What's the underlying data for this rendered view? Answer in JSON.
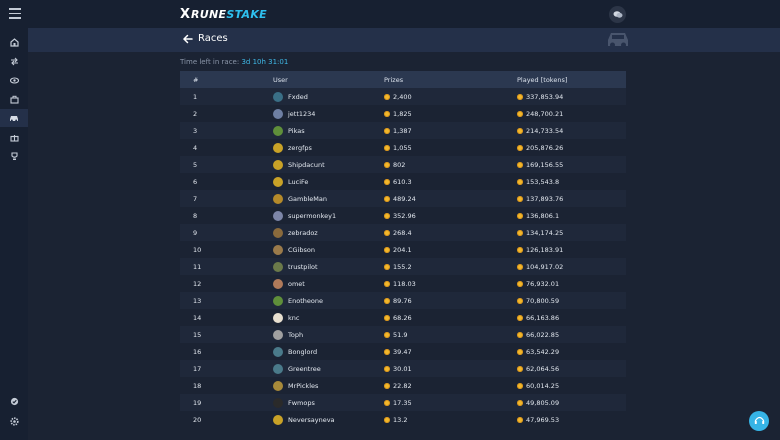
{
  "app": {
    "logo_x": "X",
    "logo_word_1": "RUNE",
    "logo_word_2": "STAKE"
  },
  "sidebar": {
    "items": [
      {
        "icon": "home-icon"
      },
      {
        "icon": "swap-icon"
      },
      {
        "icon": "eye-icon"
      },
      {
        "icon": "briefcase-icon"
      },
      {
        "icon": "car-icon",
        "active": true
      },
      {
        "icon": "gift-icon"
      },
      {
        "icon": "trophy-icon"
      },
      {
        "icon": "shield-icon"
      },
      {
        "icon": "settings-icon"
      }
    ]
  },
  "header": {
    "title": "Races"
  },
  "timer": {
    "label": "Time left in race:",
    "value": "3d 10h 31:01"
  },
  "table": {
    "columns": [
      "#",
      "User",
      "Prizes",
      "Played [tokens]"
    ],
    "rows": [
      {
        "rank": "1",
        "user": "Fxded",
        "prize": "2,400",
        "played": "337,853.94",
        "avatar_color": "#3a6f86"
      },
      {
        "rank": "2",
        "user": "jett1234",
        "prize": "1,825",
        "played": "248,700.21",
        "avatar_color": "#6e7fa3"
      },
      {
        "rank": "3",
        "user": "Pikas",
        "prize": "1,387",
        "played": "214,733.54",
        "avatar_color": "#5f8f3a"
      },
      {
        "rank": "4",
        "user": "zergfps",
        "prize": "1,055",
        "played": "205,876.26",
        "avatar_color": "#c9a227"
      },
      {
        "rank": "5",
        "user": "Shipdacunt",
        "prize": "802",
        "played": "169,156.55",
        "avatar_color": "#c9a227"
      },
      {
        "rank": "6",
        "user": "LuciFe",
        "prize": "610.3",
        "played": "153,543.8",
        "avatar_color": "#c9a227"
      },
      {
        "rank": "7",
        "user": "GambleMan",
        "prize": "489.24",
        "played": "137,893.76",
        "avatar_color": "#b58a2a"
      },
      {
        "rank": "8",
        "user": "supermonkey1",
        "prize": "352.96",
        "played": "136,806.1",
        "avatar_color": "#7d86a8"
      },
      {
        "rank": "9",
        "user": "zebradoz",
        "prize": "268.4",
        "played": "134,174.25",
        "avatar_color": "#8a6a3c"
      },
      {
        "rank": "10",
        "user": "CGibson",
        "prize": "204.1",
        "played": "126,183.91",
        "avatar_color": "#9a7a4a"
      },
      {
        "rank": "11",
        "user": "trustpilot",
        "prize": "155.2",
        "played": "104,917.02",
        "avatar_color": "#6b7a4a"
      },
      {
        "rank": "12",
        "user": "omet",
        "prize": "118.03",
        "played": "76,932.01",
        "avatar_color": "#b07a5a"
      },
      {
        "rank": "13",
        "user": "Enotheone",
        "prize": "89.76",
        "played": "70,800.59",
        "avatar_color": "#5f8f3a"
      },
      {
        "rank": "14",
        "user": "knc",
        "prize": "68.26",
        "played": "66,163.86",
        "avatar_color": "#e8e0d0"
      },
      {
        "rank": "15",
        "user": "Toph",
        "prize": "51.9",
        "played": "66,022.85",
        "avatar_color": "#a0a0a0"
      },
      {
        "rank": "16",
        "user": "Bonglord",
        "prize": "39.47",
        "played": "63,542.29",
        "avatar_color": "#4a7a8a"
      },
      {
        "rank": "17",
        "user": "Greentree",
        "prize": "30.01",
        "played": "62,064.56",
        "avatar_color": "#4a7a8a"
      },
      {
        "rank": "18",
        "user": "MrPickles",
        "prize": "22.82",
        "played": "60,014.25",
        "avatar_color": "#a88a3a"
      },
      {
        "rank": "19",
        "user": "Fwmops",
        "prize": "17.35",
        "played": "49,805.09",
        "avatar_color": "#2a2a2a"
      },
      {
        "rank": "20",
        "user": "Neversayneva",
        "prize": "13.2",
        "played": "47,969.53",
        "avatar_color": "#c9a227"
      }
    ]
  },
  "colors": {
    "accent": "#2ec0ef",
    "coin": "#f2b82c",
    "background": "#1b2333",
    "sidebar": "#172031"
  }
}
